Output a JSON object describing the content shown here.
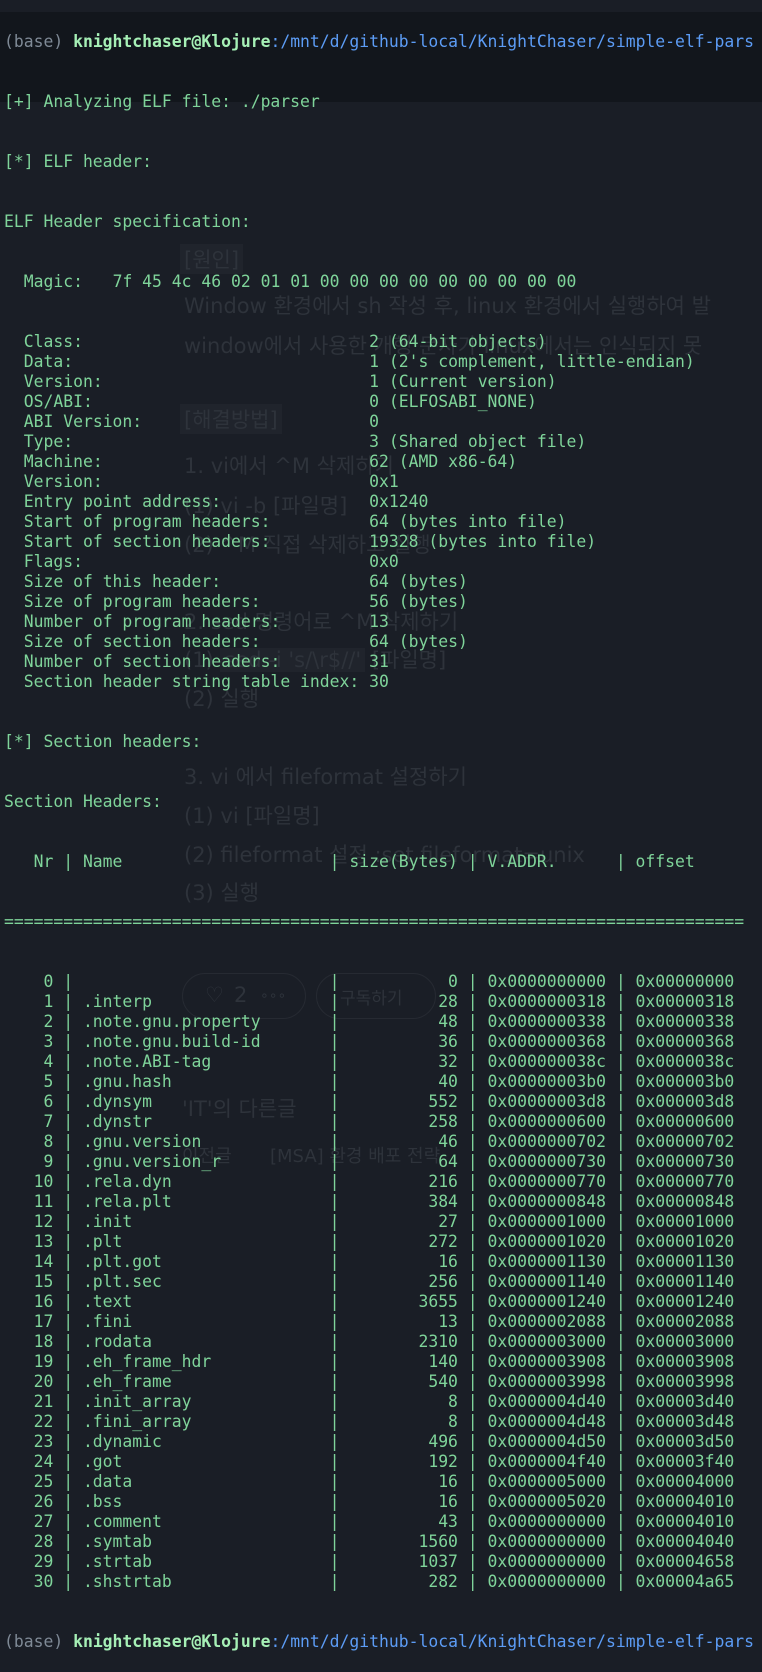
{
  "prompt": {
    "env": "(base) ",
    "user_host": "knightchaser@Klojure",
    "path": ":/mnt/d/github-local/KnightChaser/simple-elf-pars"
  },
  "output": {
    "analyzing": "[+] Analyzing ELF file: ./parser",
    "elf_header_tag": "[*] ELF header:",
    "spec_title": "ELF Header specification:",
    "magic_label": "Magic:",
    "magic_value": "7f 45 4c 46 02 01 01 00 00 00 00 00 00 00 00 00",
    "fields": [
      {
        "label": "Class:",
        "value": "2 (64-bit objects)"
      },
      {
        "label": "Data:",
        "value": "1 (2's complement, little-endian)"
      },
      {
        "label": "Version:",
        "value": "1 (Current version)"
      },
      {
        "label": "OS/ABI:",
        "value": "0 (ELFOSABI_NONE)"
      },
      {
        "label": "ABI Version:",
        "value": "0"
      },
      {
        "label": "Type:",
        "value": "3 (Shared object file)"
      },
      {
        "label": "Machine:",
        "value": "62 (AMD x86-64)"
      },
      {
        "label": "Version:",
        "value": "0x1"
      },
      {
        "label": "Entry point address:",
        "value": "0x1240"
      },
      {
        "label": "Start of program headers:",
        "value": "64 (bytes into file)"
      },
      {
        "label": "Start of section headers:",
        "value": "19328 (bytes into file)"
      },
      {
        "label": "Flags:",
        "value": "0x0"
      },
      {
        "label": "Size of this header:",
        "value": "64 (bytes)"
      },
      {
        "label": "Size of program headers:",
        "value": "56 (bytes)"
      },
      {
        "label": "Number of program headers:",
        "value": "13"
      },
      {
        "label": "Size of section headers:",
        "value": "64 (bytes)"
      },
      {
        "label": "Number of section headers:",
        "value": "31"
      },
      {
        "label": "Section header string table index:",
        "value": "30"
      }
    ],
    "section_tag": "[*] Section headers:",
    "section_title": "Section Headers:",
    "columns": [
      "Nr",
      "Name",
      "size(Bytes)",
      "V.ADDR.",
      "offset"
    ],
    "sections": [
      [
        "0",
        "",
        "0",
        "0x0000000000",
        "0x00000000"
      ],
      [
        "1",
        ".interp",
        "28",
        "0x0000000318",
        "0x00000318"
      ],
      [
        "2",
        ".note.gnu.property",
        "48",
        "0x0000000338",
        "0x00000338"
      ],
      [
        "3",
        ".note.gnu.build-id",
        "36",
        "0x0000000368",
        "0x00000368"
      ],
      [
        "4",
        ".note.ABI-tag",
        "32",
        "0x000000038c",
        "0x0000038c"
      ],
      [
        "5",
        ".gnu.hash",
        "40",
        "0x00000003b0",
        "0x000003b0"
      ],
      [
        "6",
        ".dynsym",
        "552",
        "0x00000003d8",
        "0x000003d8"
      ],
      [
        "7",
        ".dynstr",
        "258",
        "0x0000000600",
        "0x00000600"
      ],
      [
        "8",
        ".gnu.version",
        "46",
        "0x0000000702",
        "0x00000702"
      ],
      [
        "9",
        ".gnu.version_r",
        "64",
        "0x0000000730",
        "0x00000730"
      ],
      [
        "10",
        ".rela.dyn",
        "216",
        "0x0000000770",
        "0x00000770"
      ],
      [
        "11",
        ".rela.plt",
        "384",
        "0x0000000848",
        "0x00000848"
      ],
      [
        "12",
        ".init",
        "27",
        "0x0000001000",
        "0x00001000"
      ],
      [
        "13",
        ".plt",
        "272",
        "0x0000001020",
        "0x00001020"
      ],
      [
        "14",
        ".plt.got",
        "16",
        "0x0000001130",
        "0x00001130"
      ],
      [
        "15",
        ".plt.sec",
        "256",
        "0x0000001140",
        "0x00001140"
      ],
      [
        "16",
        ".text",
        "3655",
        "0x0000001240",
        "0x00001240"
      ],
      [
        "17",
        ".fini",
        "13",
        "0x0000002088",
        "0x00002088"
      ],
      [
        "18",
        ".rodata",
        "2310",
        "0x0000003000",
        "0x00003000"
      ],
      [
        "19",
        ".eh_frame_hdr",
        "140",
        "0x0000003908",
        "0x00003908"
      ],
      [
        "20",
        ".eh_frame",
        "540",
        "0x0000003998",
        "0x00003998"
      ],
      [
        "21",
        ".init_array",
        "8",
        "0x0000004d40",
        "0x00003d40"
      ],
      [
        "22",
        ".fini_array",
        "8",
        "0x0000004d48",
        "0x00003d48"
      ],
      [
        "23",
        ".dynamic",
        "496",
        "0x0000004d50",
        "0x00003d50"
      ],
      [
        "24",
        ".got",
        "192",
        "0x0000004f40",
        "0x00003f40"
      ],
      [
        "25",
        ".data",
        "16",
        "0x0000005000",
        "0x00004000"
      ],
      [
        "26",
        ".bss",
        "16",
        "0x0000005020",
        "0x00004010"
      ],
      [
        "27",
        ".comment",
        "43",
        "0x0000000000",
        "0x00004010"
      ],
      [
        "28",
        ".symtab",
        "1560",
        "0x0000000000",
        "0x00004040"
      ],
      [
        "29",
        ".strtab",
        "1037",
        "0x0000000000",
        "0x00004658"
      ],
      [
        "30",
        ".shstrtab",
        "282",
        "0x0000000000",
        "0x00004a65"
      ]
    ]
  },
  "background_blog": {
    "cause_heading": "[원인]",
    "cause_1": "Window 환경에서 sh 작성 후, linux 환경에서 실행하여 발",
    "cause_2": "window에서 사용한 개행 문자가 linux에서는 인식되지 못",
    "solution_heading": "[해결방법]",
    "s1": "1. vi에서 ^M 삭제하기",
    "s1_1": "(1) vi -b [파일명]",
    "s1_2": "(2) ^M 직접 삭제하고 실행",
    "s2": "2. sed 명령어로 ^M 삭제하기",
    "s2_1_num": "(1) ",
    "s2_1_cmd": "sed -i 's/\\r$//'",
    "s2_1_arg": " [파일명]",
    "s2_2": "(2) 실행",
    "s3": "3. vi 에서 fileformat 설정하기",
    "s3_1": "(1) vi [파일명]",
    "s3_2": "(2) fileformat 설정 :set fileformat=unix",
    "s3_3": "(3) 실행",
    "like_count": "2",
    "subscribe": "구독하기",
    "other_posts": "'IT'의 다른글",
    "prev_label": "이전글",
    "prev_title": "[MSA] 환경 배포 전략"
  },
  "colors": {
    "terminal_bg": "#1a1e26",
    "text_green": "#7fd49a",
    "path_blue": "#5c9cf5"
  }
}
